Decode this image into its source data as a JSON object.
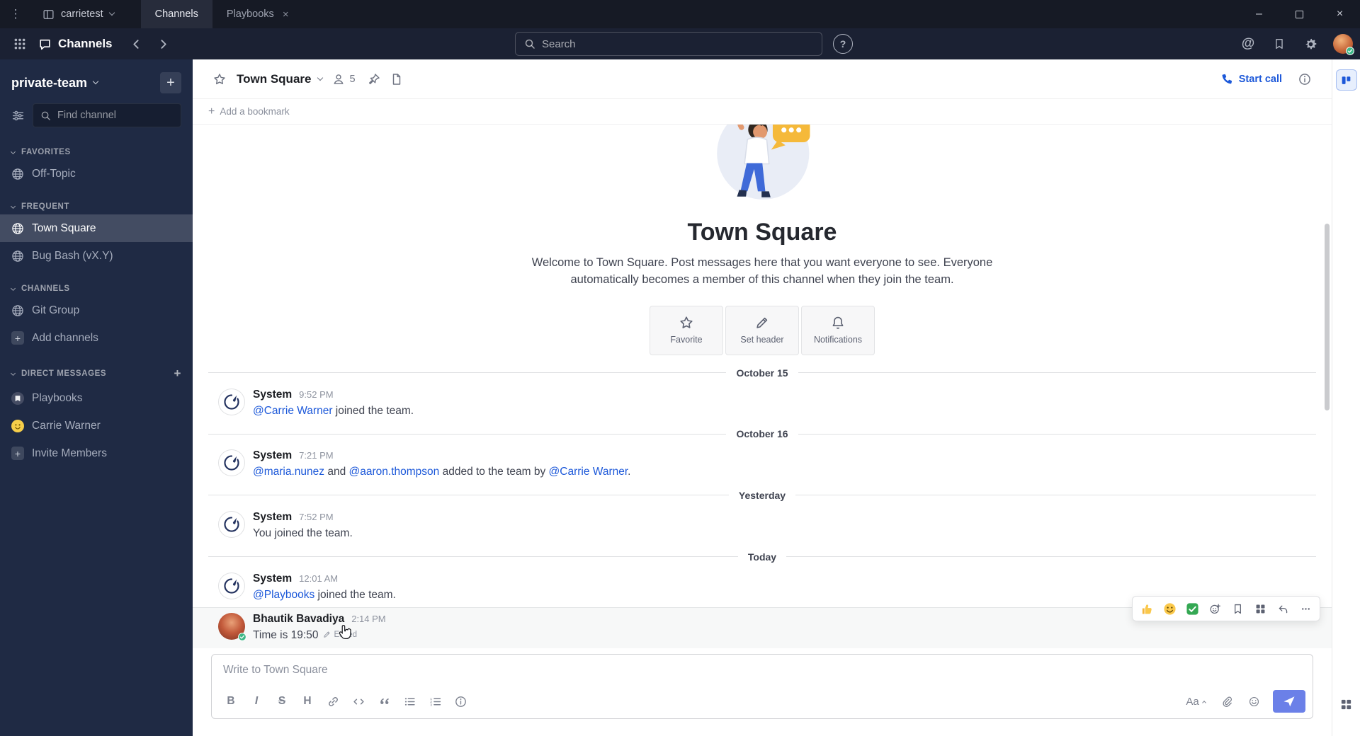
{
  "icons": {
    "menu_dots": "⋮",
    "minimize": "–",
    "close": "×",
    "plus": "+",
    "help": "?",
    "at_mention": "@"
  },
  "titlebar": {
    "server_name": "carrietest",
    "tabs": [
      {
        "label": "Channels",
        "active": true,
        "closable": false
      },
      {
        "label": "Playbooks",
        "active": false,
        "closable": true
      }
    ]
  },
  "global_header": {
    "product_name": "Channels",
    "search_placeholder": "Search"
  },
  "sidebar": {
    "team_name": "private-team",
    "find_placeholder": "Find channel",
    "sections": [
      {
        "title": "FAVORITES",
        "add": false,
        "items": [
          {
            "label": "Off-Topic",
            "icon": "globe",
            "active": false
          }
        ]
      },
      {
        "title": "FREQUENT",
        "add": false,
        "items": [
          {
            "label": "Town Square",
            "icon": "globe",
            "active": true
          },
          {
            "label": "Bug Bash (vX.Y)",
            "icon": "globe",
            "active": false
          }
        ]
      },
      {
        "title": "CHANNELS",
        "add": false,
        "items": [
          {
            "label": "Git Group",
            "icon": "globe",
            "active": false
          },
          {
            "label": "Add channels",
            "icon": "plus",
            "active": false
          }
        ]
      },
      {
        "title": "DIRECT MESSAGES",
        "add": true,
        "items": [
          {
            "label": "Playbooks",
            "icon": "playbooks",
            "active": false
          },
          {
            "label": "Carrie Warner",
            "icon": "carrie",
            "active": false
          },
          {
            "label": "Invite Members",
            "icon": "plus",
            "active": false
          }
        ]
      }
    ]
  },
  "channel_header": {
    "name": "Town Square",
    "member_count": "5",
    "start_call_label": "Start call",
    "bookmark_label": "Add a bookmark"
  },
  "intro": {
    "title": "Town Square",
    "description": "Welcome to Town Square. Post messages here that you want everyone to see. Everyone automatically becomes a member of this channel when they join the team.",
    "actions": [
      {
        "label": "Favorite",
        "icon": "star"
      },
      {
        "label": "Set header",
        "icon": "pencil"
      },
      {
        "label": "Notifications",
        "icon": "bell"
      }
    ]
  },
  "timeline": [
    {
      "type": "divider",
      "label": "October 15"
    },
    {
      "type": "message",
      "author": "System",
      "avatar": "system",
      "time": "9:52 PM",
      "segments": [
        {
          "kind": "link",
          "text": "@Carrie Warner"
        },
        {
          "kind": "text",
          "text": " joined the team."
        }
      ]
    },
    {
      "type": "divider",
      "label": "October 16"
    },
    {
      "type": "message",
      "author": "System",
      "avatar": "system",
      "time": "7:21 PM",
      "segments": [
        {
          "kind": "link",
          "text": "@maria.nunez"
        },
        {
          "kind": "text",
          "text": " and "
        },
        {
          "kind": "link",
          "text": "@aaron.thompson"
        },
        {
          "kind": "text",
          "text": " added to the team by "
        },
        {
          "kind": "link",
          "text": "@Carrie Warner"
        },
        {
          "kind": "text",
          "text": "."
        }
      ]
    },
    {
      "type": "divider",
      "label": "Yesterday"
    },
    {
      "type": "message",
      "author": "System",
      "avatar": "system",
      "time": "7:52 PM",
      "segments": [
        {
          "kind": "text",
          "text": "You joined the team."
        }
      ]
    },
    {
      "type": "divider",
      "label": "Today"
    },
    {
      "type": "message",
      "author": "System",
      "avatar": "system",
      "time": "12:01 AM",
      "segments": [
        {
          "kind": "link",
          "text": "@Playbooks"
        },
        {
          "kind": "text",
          "text": " joined the team."
        }
      ]
    },
    {
      "type": "message",
      "author": "Bhautik Bavadiya",
      "avatar": "photo",
      "time": "2:14 PM",
      "hovered": true,
      "segments": [
        {
          "kind": "text",
          "text": "Time is 19:50"
        },
        {
          "kind": "edited",
          "text": "Edited"
        }
      ]
    }
  ],
  "hover_toolbar": {
    "quick_reactions": [
      {
        "name": "thumbs-up-reaction-button",
        "icon": "thumbsup"
      },
      {
        "name": "smile-reaction-button",
        "icon": "smileEmoji"
      },
      {
        "name": "check-mark-reaction-button",
        "icon": "checkEmoji"
      }
    ],
    "actions": [
      {
        "name": "add-reaction-button",
        "icon": "addReaction"
      },
      {
        "name": "save-message-button",
        "icon": "bookmark"
      },
      {
        "name": "message-actions-button",
        "icon": "actionsGrid"
      },
      {
        "name": "reply-button",
        "icon": "reply"
      },
      {
        "name": "more-actions-button",
        "icon": "moreDots"
      }
    ]
  },
  "composer": {
    "placeholder": "Write to Town Square",
    "left_tools": [
      {
        "name": "bold-button",
        "glyph": "B"
      },
      {
        "name": "italic-button",
        "glyph": "I"
      },
      {
        "name": "strikethrough-button",
        "glyph": "S"
      },
      {
        "name": "heading-button",
        "glyph": "H"
      },
      {
        "name": "link-button",
        "icon": "link"
      },
      {
        "name": "code-button",
        "icon": "code"
      },
      {
        "name": "quote-button",
        "icon": "quote"
      },
      {
        "name": "bulleted-list-button",
        "icon": "ul"
      },
      {
        "name": "numbered-list-button",
        "icon": "ol"
      },
      {
        "name": "formatting-help-button",
        "icon": "info"
      }
    ],
    "right_tools": [
      {
        "name": "formatting-toggle-button",
        "glyph": "Aa"
      },
      {
        "name": "attach-file-button",
        "icon": "clip"
      },
      {
        "name": "emoji-picker-button",
        "icon": "smileOutline"
      },
      {
        "name": "send-button",
        "icon": "send"
      }
    ]
  },
  "colors": {
    "accent_blue": "#1c58d9",
    "link_blue": "#1c58d9",
    "online_green": "#3db887",
    "titlebar_bg": "#161a25",
    "header_bg": "#1b2133",
    "sidebar_bg": "#1f2a44"
  }
}
